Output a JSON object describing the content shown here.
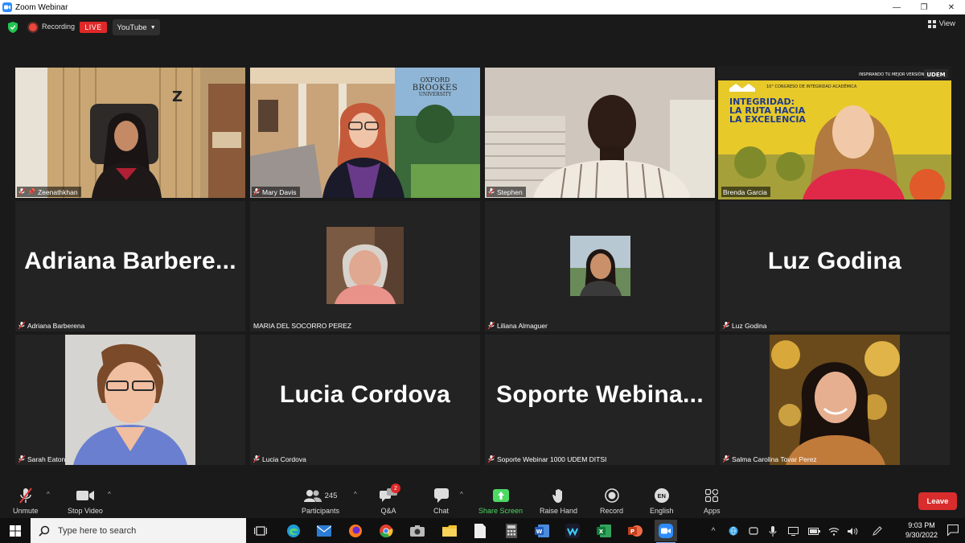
{
  "window": {
    "title": "Zoom Webinar"
  },
  "status": {
    "recording_label": "Recording",
    "live_label": "LIVE",
    "stream_target": "YouTube",
    "view_label": "View"
  },
  "participants_grid": [
    {
      "name": "Zeenathkhan",
      "muted": true,
      "pinned": true,
      "type": "video"
    },
    {
      "name": "Mary Davis",
      "muted": true,
      "type": "video",
      "overlay_logo": "OXFORD BROOKES UNIVERSITY"
    },
    {
      "name": "Stephen",
      "muted": true,
      "type": "video"
    },
    {
      "name": "Brenda Garcia",
      "muted": false,
      "type": "video",
      "active_speaker": true,
      "banner": {
        "tagline": "INSPIRANDO TU MEJOR VERSIÓN",
        "brand": "UDEM",
        "event": "10° CONGRESO DE INTEGRIDAD ACADÉMICA",
        "headline1": "INTEGRIDAD:",
        "headline2": "LA RUTA HACIA",
        "headline3": "LA EXCELENCIA"
      }
    },
    {
      "name": "Adriana Barberena",
      "muted": true,
      "type": "name",
      "display": "Adriana  Barbere..."
    },
    {
      "name": "MARIA DEL SOCORRO PEREZ",
      "muted": false,
      "type": "photo"
    },
    {
      "name": "Liliana Almaguer",
      "muted": true,
      "type": "photo"
    },
    {
      "name": "Luz Godina",
      "muted": true,
      "type": "name",
      "display": "Luz Godina"
    },
    {
      "name": "Sarah Eaton",
      "muted": true,
      "type": "photo"
    },
    {
      "name": "Lucia Cordova",
      "muted": true,
      "type": "name",
      "display": "Lucia Cordova"
    },
    {
      "name": "Soporte Webinar 1000 UDEM DITSI",
      "muted": true,
      "type": "name",
      "display": "Soporte  Webina..."
    },
    {
      "name": "Salma Carolina Tovar Perez",
      "muted": true,
      "type": "photo"
    }
  ],
  "toolbar": {
    "unmute": "Unmute",
    "stop_video": "Stop Video",
    "participants": "Participants",
    "participants_count": "245",
    "qa": "Q&A",
    "qa_badge": "2",
    "chat": "Chat",
    "share_screen": "Share Screen",
    "raise_hand": "Raise Hand",
    "record": "Record",
    "language_code": "EN",
    "language": "English",
    "apps": "Apps",
    "leave": "Leave"
  },
  "taskbar": {
    "search_placeholder": "Type here to search",
    "time": "9:03 PM",
    "date": "9/30/2022"
  },
  "colors": {
    "speaker_outline": "#e2e05a",
    "live_red": "#e02828",
    "share_green": "#4cd964",
    "leave_red": "#d92c2c"
  }
}
